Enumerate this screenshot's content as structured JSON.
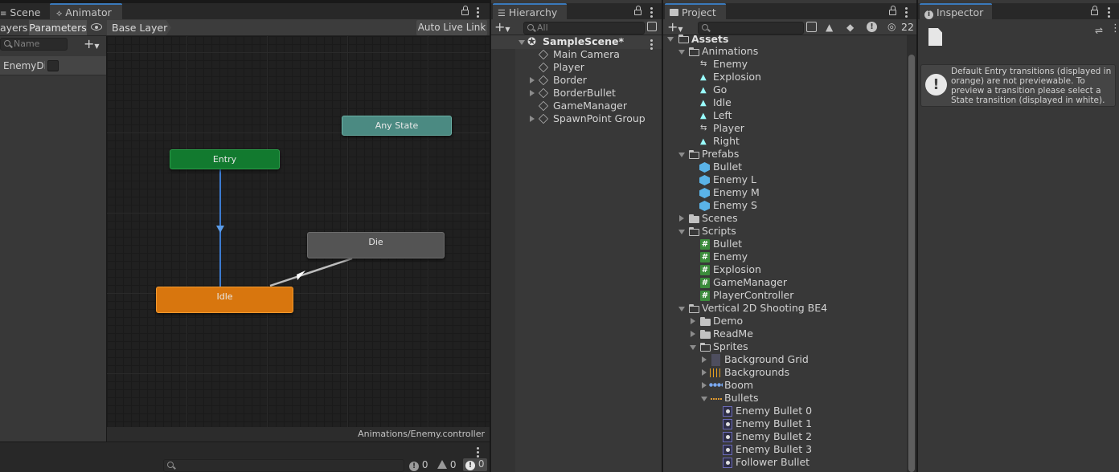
{
  "animator": {
    "tabs": {
      "scene": "Scene",
      "animator": "Animator"
    },
    "toolbar": {
      "layers": "ayers",
      "parameters": "Parameters",
      "breadcrumb": "Base Layer",
      "auto_live_link": "Auto Live Link"
    },
    "search_placeholder": "Name",
    "parameter": {
      "name": "EnemyDie"
    },
    "states": {
      "any_state": "Any State",
      "entry": "Entry",
      "die": "Die",
      "idle": "Idle"
    },
    "footer_path": "Animations/Enemy.controller"
  },
  "console_bar": {
    "errors": "0",
    "warnings": "0",
    "logs": "0"
  },
  "hierarchy": {
    "tab": "Hierarchy",
    "search_placeholder": "All",
    "scene": "SampleScene*",
    "items": [
      "Main Camera",
      "Player",
      "Border",
      "BorderBullet",
      "GameManager",
      "SpawnPoint Group"
    ]
  },
  "project": {
    "tab": "Project",
    "hidden_count": "22",
    "root": "Assets",
    "animations": {
      "label": "Animations",
      "items": [
        "Enemy",
        "Explosion",
        "Go",
        "Idle",
        "Left",
        "Player",
        "Right"
      ]
    },
    "prefabs": {
      "label": "Prefabs",
      "items": [
        "Bullet",
        "Enemy L",
        "Enemy M",
        "Enemy S"
      ]
    },
    "scenes": "Scenes",
    "scripts": {
      "label": "Scripts",
      "items": [
        "Bullet",
        "Enemy",
        "Explosion",
        "GameManager",
        "PlayerController"
      ]
    },
    "vertical": {
      "label": "Vertical 2D Shooting BE4",
      "demo": "Demo",
      "readme": "ReadMe",
      "sprites": "Sprites",
      "sprite_items": {
        "background_grid": "Background Grid",
        "backgrounds": "Backgrounds",
        "boom": "Boom",
        "bullets": "Bullets"
      },
      "bullet_items": [
        "Enemy Bullet 0",
        "Enemy Bullet 1",
        "Enemy Bullet 2",
        "Enemy Bullet 3",
        "Follower Bullet"
      ]
    }
  },
  "inspector": {
    "tab": "Inspector",
    "message": "Default Entry transitions (displayed in orange) are not previewable. To preview a transition please select a State transition (displayed in white)."
  }
}
